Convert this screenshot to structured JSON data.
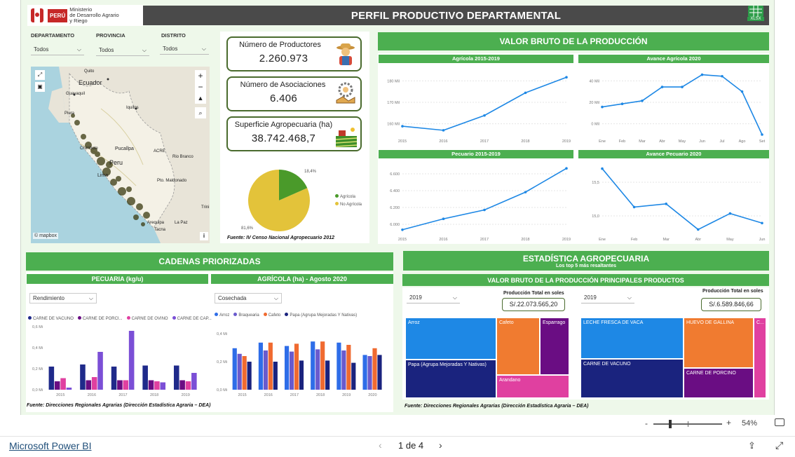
{
  "header": {
    "ministry_line1": "Ministerio",
    "ministry_line2": "de Desarrollo Agrario",
    "ministry_line3": "y Riego",
    "peru": "PERÚ",
    "title": "PERFIL PRODUCTIVO DEPARTAMENTAL",
    "xlsx": "XLSX"
  },
  "filters": [
    {
      "label": "DEPARTAMENTO",
      "value": "Todos"
    },
    {
      "label": "PROVINCIA",
      "value": "Todos"
    },
    {
      "label": "DISTRITO",
      "value": "Todos"
    }
  ],
  "map": {
    "labels": [
      "Quito",
      "Ecuador",
      "Guayaquil",
      "Piura",
      "Iquitos",
      "Chimbote",
      "Pucallpa",
      "ACRE",
      "Peru",
      "Rio Branco",
      "Lima",
      "Trini",
      "Pto. Maldonado",
      "La Paz",
      "Arequipa",
      "Tacna"
    ],
    "attribution": "© mapbox"
  },
  "kpis": [
    {
      "title": "Número de Productores",
      "value": "2.260.973"
    },
    {
      "title": "Número de Asociaciones",
      "value": "6.406"
    },
    {
      "title": "Superficie Agropecuaria (ha)",
      "value": "38.742.468,7"
    }
  ],
  "pie": {
    "pct_agricola": "18,4%",
    "pct_no_agricola": "81,6%",
    "legend": [
      "Agrícola",
      "No Agrícola"
    ],
    "colors": [
      "#4a9a2a",
      "#e3c33a"
    ],
    "values": [
      18.4,
      81.6
    ],
    "source": "Fuente: IV Censo Nacional Agropecuario 2012"
  },
  "vbp": {
    "title": "VALOR BRUTO DE LA PRODUCCIÓN"
  },
  "chart_data": [
    {
      "type": "line",
      "title": "Agrícola 2015-2019",
      "x": [
        "2015",
        "2016",
        "2017",
        "2018",
        "2019"
      ],
      "values": [
        160.5,
        158.8,
        165,
        174.5,
        181
      ],
      "yticks": [
        "160 Mil",
        "170 Mil",
        "180 Mil"
      ],
      "ylim": [
        157,
        184
      ]
    },
    {
      "type": "line",
      "title": "Avance Agrícola 2020",
      "x": [
        "Ene",
        "Feb",
        "Mar",
        "Abr",
        "May",
        "Jun",
        "Jul",
        "Ago",
        "Set"
      ],
      "values": [
        18,
        20,
        22,
        31,
        31,
        39,
        38,
        28,
        0
      ],
      "yticks": [
        "0 Mil",
        "20 Mil",
        "40 Mil"
      ],
      "ylim": [
        0,
        42
      ]
    },
    {
      "type": "line",
      "title": "Pecuario 2015-2019",
      "x": [
        "2015",
        "2016",
        "2017",
        "2018",
        "2019"
      ],
      "values": [
        5970,
        6080,
        6170,
        6350,
        6590
      ],
      "yticks": [
        "6.000",
        "6.200",
        "6.400",
        "6.600"
      ],
      "ylim": [
        5940,
        6620
      ]
    },
    {
      "type": "line",
      "title": "Avance Pecuario 2020",
      "x": [
        "Ene",
        "Feb",
        "Mar",
        "Abr",
        "May",
        "Jun"
      ],
      "values": [
        15.9,
        15.3,
        15.35,
        14.95,
        15.2,
        15.05
      ],
      "yticks": [
        "15,0",
        "15,5"
      ],
      "ylim": [
        14.9,
        15.95
      ]
    },
    {
      "type": "bar",
      "title": "PECUARIA (kg/u)",
      "categories": [
        "2015",
        "2016",
        "2017",
        "2018",
        "2019"
      ],
      "series": [
        {
          "name": "CARNE DE VACUNO",
          "values": [
            0.22,
            0.24,
            0.22,
            0.23,
            0.23
          ]
        },
        {
          "name": "CARNE DE PORCI...",
          "values": [
            0.08,
            0.09,
            0.09,
            0.09,
            0.09
          ]
        },
        {
          "name": "CARNE DE OVINO",
          "values": [
            0.11,
            0.12,
            0.09,
            0.08,
            0.08
          ]
        },
        {
          "name": "CARNE DE CAP...",
          "values": [
            0.02,
            0.36,
            0.56,
            0.07,
            0.16
          ]
        }
      ],
      "yticks": [
        "0,0 Mi",
        "0,2 Mi",
        "0,4 Mi",
        "0,6 Mi"
      ],
      "ylim": [
        0,
        0.6
      ],
      "colors": [
        "#1f2a8a",
        "#6a0d83",
        "#e040a0",
        "#7b4fd6"
      ]
    },
    {
      "type": "bar",
      "title": "AGRÍCOLA (ha) - Agosto 2020",
      "categories": [
        "2015",
        "2016",
        "2017",
        "2018",
        "2019",
        "2020"
      ],
      "series": [
        {
          "name": "Arroz",
          "values": [
            0.37,
            0.42,
            0.39,
            0.43,
            0.42,
            0.31
          ]
        },
        {
          "name": "Braquearia",
          "values": [
            0.32,
            0.35,
            0.34,
            0.36,
            0.35,
            0.3
          ]
        },
        {
          "name": "Cafeto",
          "values": [
            0.3,
            0.42,
            0.41,
            0.43,
            0.4,
            0.37
          ]
        },
        {
          "name": "Papa (Agrupa Mejoradas Y Nativas)",
          "values": [
            0.25,
            0.25,
            0.26,
            0.26,
            0.24,
            0.31
          ]
        }
      ],
      "yticks": [
        "0,0 Mi",
        "0,2 Mi",
        "0,4 Mi"
      ],
      "ylim": [
        0,
        0.5
      ],
      "colors": [
        "#2e6de8",
        "#6a5acd",
        "#f06a30",
        "#1a237e"
      ]
    }
  ],
  "stats": {
    "title": "ESTADÍSTICA AGROPECUARIA",
    "subtitle": "Los top 5 más resaltantes",
    "vbp_products_title": "VALOR BRUTO DE LA PRODUCCIÓN PRINCIPALES PRODUCTOS",
    "source": "Fuente: Direcciones Regionales Agrarias (Dirección Estadística Agraria – DEA)"
  },
  "cadenas": {
    "title": "CADENAS PRIORIZADAS",
    "pec_select": "Rendimiento",
    "agr_select": "Cosechada",
    "source": "Fuente: Direcciones Regionales Agrarias (Dirección Estadística Agraria – DEA)"
  },
  "treemaps": [
    {
      "year": "2019",
      "total_label": "Producción Total en soles",
      "total": "S/.22.073.565,20",
      "items": [
        "Arroz",
        "Cafeto",
        "Esparrago",
        "Papa (Agrupa Mejoradas Y Nativas)",
        "Arandano"
      ]
    },
    {
      "year": "2019",
      "total_label": "Producción Total en soles",
      "total": "S/.6.589.846,66",
      "items": [
        "LECHE FRESCA DE VACA",
        "HUEVO DE GALLINA",
        "C...",
        "CARNE DE VACUNO",
        "CARNE DE PORCINO"
      ]
    }
  ],
  "footer": {
    "brand": "Microsoft Power BI",
    "page": "1 de 4",
    "zoom": "54%"
  }
}
